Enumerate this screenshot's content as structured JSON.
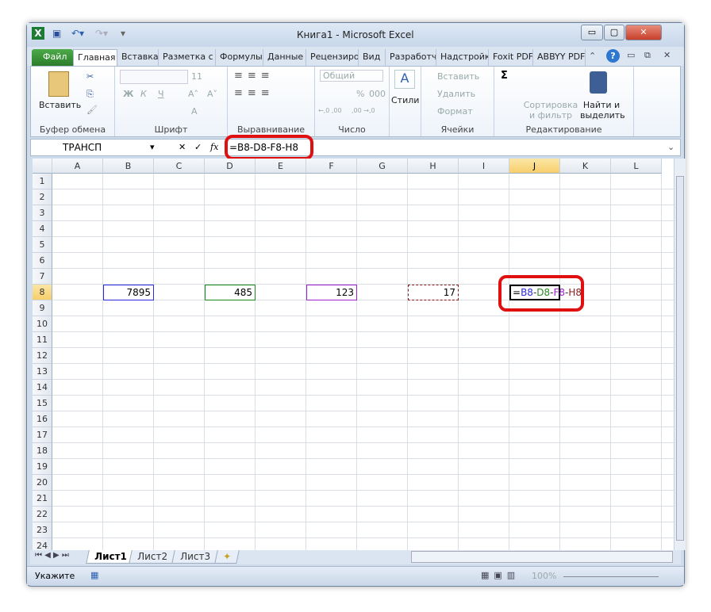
{
  "window": {
    "title": "Книга1 - Microsoft Excel",
    "minimize": "▭",
    "restore": "▢",
    "close": "✕"
  },
  "quick_access": {
    "save": "save-icon",
    "undo": "undo-icon",
    "redo": "redo-icon"
  },
  "tabs": [
    "Файл",
    "Главная",
    "Вставка",
    "Разметка с",
    "Формулы",
    "Данные",
    "Рецензиро",
    "Вид",
    "Разработч",
    "Надстройк",
    "Foxit PDF",
    "ABBYY PDF"
  ],
  "active_tab": "Главная",
  "ribbon": {
    "clipboard": {
      "label": "Буфер обмена",
      "paste": "Вставить"
    },
    "font": {
      "label": "Шрифт",
      "font_name": "",
      "font_size": "11",
      "bold": "Ж",
      "italic": "К",
      "underline": "Ч",
      "grow": "A˄",
      "shrink": "A˅",
      "color": "A"
    },
    "alignment": {
      "label": "Выравнивание"
    },
    "number": {
      "label": "Число",
      "format": "Общий",
      "percent": "%",
      "thousands": "000",
      "inc": "←,0 ,00",
      "dec": ",00 →,0"
    },
    "styles": {
      "label": "Стили"
    },
    "cells": {
      "label": "Ячейки",
      "insert": "Вставить",
      "delete": "Удалить",
      "format": "Формат"
    },
    "editing": {
      "label": "Редактирование",
      "sum": "Σ",
      "sort": "Сортировка",
      "sort2": "и фильтр",
      "find": "Найти и",
      "find2": "выделить"
    }
  },
  "formula_bar": {
    "name_box": "ТРАНСП",
    "cancel": "✕",
    "enter": "✓",
    "fx": "fx",
    "formula": "=B8-D8-F8-H8"
  },
  "columns": [
    "A",
    "B",
    "C",
    "D",
    "E",
    "F",
    "G",
    "H",
    "I",
    "J",
    "K",
    "L"
  ],
  "selected_column": "J",
  "rows": [
    "1",
    "2",
    "3",
    "4",
    "5",
    "6",
    "7",
    "8",
    "9",
    "10",
    "11",
    "12",
    "13",
    "14",
    "15",
    "16",
    "17",
    "18",
    "19",
    "20",
    "21",
    "22",
    "23",
    "24"
  ],
  "selected_row": "8",
  "cells": {
    "B8": "7895",
    "D8": "485",
    "F8": "123",
    "H8": "17"
  },
  "edit_cell": {
    "eq": "=",
    "parts": [
      {
        "t": "B8",
        "c": "#2a2ae0"
      },
      {
        "t": "-",
        "c": "#333"
      },
      {
        "t": "D8",
        "c": "#2a8a2a"
      },
      {
        "t": "-",
        "c": "#333"
      },
      {
        "t": "F8",
        "c": "#a020d0"
      },
      {
        "t": "-",
        "c": "#333"
      },
      {
        "t": "H8",
        "c": "#8a2020"
      }
    ]
  },
  "ref_colors": {
    "B8": "#2a2ae0",
    "D8": "#1a8a1a",
    "F8": "#a020d0",
    "H8": "#8a1a1a"
  },
  "sheets": [
    "Лист1",
    "Лист2",
    "Лист3"
  ],
  "active_sheet": "Лист1",
  "status": {
    "mode": "Укажите",
    "zoom": "100%"
  }
}
